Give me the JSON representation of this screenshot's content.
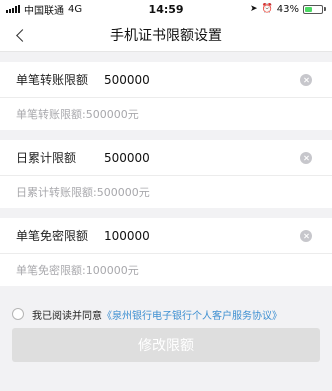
{
  "status_bar": {
    "carrier": "中国联通",
    "network": "4G",
    "time": "14:59",
    "battery_percent": "43%"
  },
  "navbar": {
    "title": "手机证书限额设置"
  },
  "limits": [
    {
      "label": "单笔转账限额",
      "value": "500000",
      "hint": "单笔转账限额:500000元"
    },
    {
      "label": "日累计限额",
      "value": "500000",
      "hint": "日累计转账限额:500000元"
    },
    {
      "label": "单笔免密限额",
      "value": "100000",
      "hint": "单笔免密限额:100000元"
    }
  ],
  "agreement": {
    "text": "我已阅读并同意",
    "link": "《泉州银行电子银行个人客户服务协议》"
  },
  "submit_label": "修改限额",
  "colors": {
    "link": "#3d8fd1",
    "disabled_button": "#dedede",
    "battery": "#4cd964"
  }
}
